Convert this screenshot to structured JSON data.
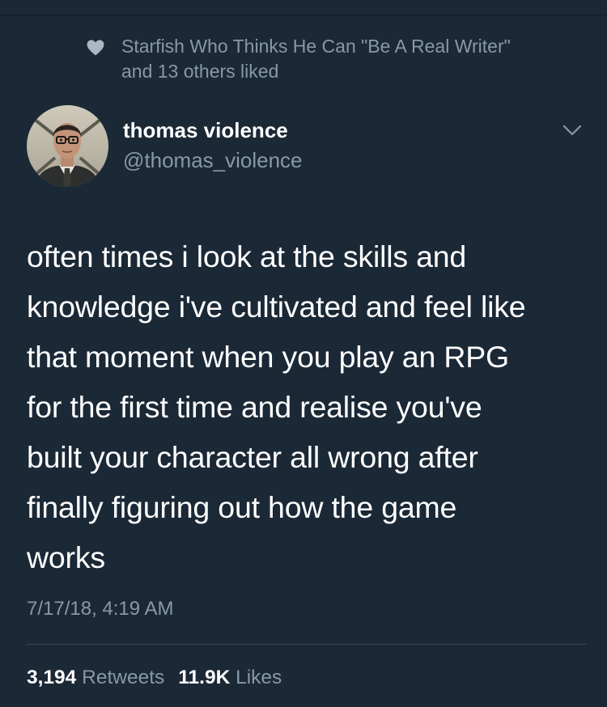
{
  "social_context": {
    "icon": "heart-icon",
    "line1": "Starfish Who Thinks He Can \"Be A Real Writer\"",
    "line2": "and 13 others liked"
  },
  "author": {
    "name": "thomas violence",
    "handle": "@thomas_violence"
  },
  "tweet": {
    "lines": [
      "often times i look at the skills and",
      "knowledge i've cultivated and feel like",
      "that moment when you play an RPG",
      "for the first time and realise you've",
      "built your character all wrong after",
      "finally figuring out how the game",
      "works"
    ],
    "timestamp": "7/17/18, 4:19 AM"
  },
  "stats": {
    "retweets_count": "3,194",
    "retweets_label": "Retweets",
    "likes_count": "11.9K",
    "likes_label": "Likes"
  },
  "colors": {
    "background": "#1b2836",
    "secondary_text": "#8899a6",
    "primary_text": "#ffffff",
    "divider": "#38444d"
  }
}
